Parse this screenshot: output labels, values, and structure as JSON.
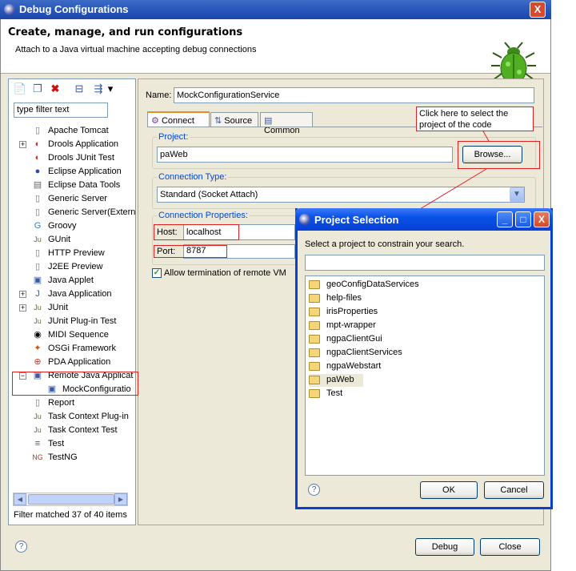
{
  "window": {
    "title": "Debug Configurations",
    "close_symbol": "X"
  },
  "header": {
    "heading": "Create, manage, and run configurations",
    "description": "Attach to a Java virtual machine accepting debug connections"
  },
  "left_toolbar": {
    "new": "📄",
    "duplicate": "❐",
    "delete": "✖",
    "collapse": "⊟",
    "filter": "⇶",
    "menu": "▾"
  },
  "filter_input": {
    "value": "type filter text"
  },
  "tree": [
    {
      "label": "Apache Tomcat",
      "icon": "▯"
    },
    {
      "label": "Drools Application",
      "icon": "◐"
    },
    {
      "label": "Drools JUnit Test",
      "icon": "◐"
    },
    {
      "label": "Eclipse Application",
      "icon": "●"
    },
    {
      "label": "Eclipse Data Tools",
      "icon": "▤"
    },
    {
      "label": "Generic Server",
      "icon": "▯"
    },
    {
      "label": "Generic Server(Extern",
      "icon": "▯"
    },
    {
      "label": "Groovy",
      "icon": "G"
    },
    {
      "label": "GUnit",
      "icon": "Ju"
    },
    {
      "label": "HTTP Preview",
      "icon": "▯"
    },
    {
      "label": "J2EE Preview",
      "icon": "▯"
    },
    {
      "label": "Java Applet",
      "icon": "▣"
    },
    {
      "label": "Java Application",
      "icon": "J"
    },
    {
      "label": "JUnit",
      "icon": "Ju"
    },
    {
      "label": "JUnit Plug-in Test",
      "icon": "Ju"
    },
    {
      "label": "MIDI Sequence",
      "icon": "◉"
    },
    {
      "label": "OSGi Framework",
      "icon": "✦"
    },
    {
      "label": "PDA Application",
      "icon": "⊕"
    },
    {
      "label": "Remote Java Applicat",
      "icon": "▣"
    },
    {
      "label": "MockConfiguratio",
      "icon": "▣"
    },
    {
      "label": "Report",
      "icon": "▯"
    },
    {
      "label": "Task Context Plug-in",
      "icon": "Ju"
    },
    {
      "label": "Task Context Test",
      "icon": "Ju"
    },
    {
      "label": "Test",
      "icon": "≡"
    },
    {
      "label": "TestNG",
      "icon": "NG"
    }
  ],
  "tree_status": "Filter matched 37 of 40 items",
  "scroll": {
    "left": "◀",
    "right": "▶"
  },
  "config": {
    "name_label": "Name:",
    "name_value": "MockConfigurationService",
    "tabs": [
      {
        "label": "Connect",
        "icon": "⚙"
      },
      {
        "label": "Source",
        "icon": "⇅"
      },
      {
        "label": "Common",
        "icon": "▤"
      }
    ],
    "project_group": "Project:",
    "project_value": "paWeb",
    "browse_label": "Browse...",
    "connection_type_group": "Connection Type:",
    "connection_type_value": "Standard (Socket Attach)",
    "connection_props_group": "Connection Properties:",
    "host_label": "Host:",
    "host_value": "localhost",
    "port_label": "Port:",
    "port_value": "8787",
    "allow_termination_label": "Allow termination of remote VM",
    "allow_termination_checked": true
  },
  "callout": {
    "text": "Click here to select the project of the code"
  },
  "bottom": {
    "help": "?",
    "debug_label": "Debug",
    "close_label": "Close"
  },
  "dialog": {
    "title": "Project Selection",
    "min": "_",
    "max": "□",
    "close": "X",
    "instruction": "Select a project to constrain your search.",
    "search_value": "",
    "projects": [
      "geoConfigDataServices",
      "help-files",
      "irisProperties",
      "mpt-wrapper",
      "ngpaClientGui",
      "ngpaClientServices",
      "ngpaWebstart",
      "paWeb",
      "Test"
    ],
    "selected": "paWeb",
    "help": "?",
    "ok_label": "OK",
    "cancel_label": "Cancel"
  }
}
